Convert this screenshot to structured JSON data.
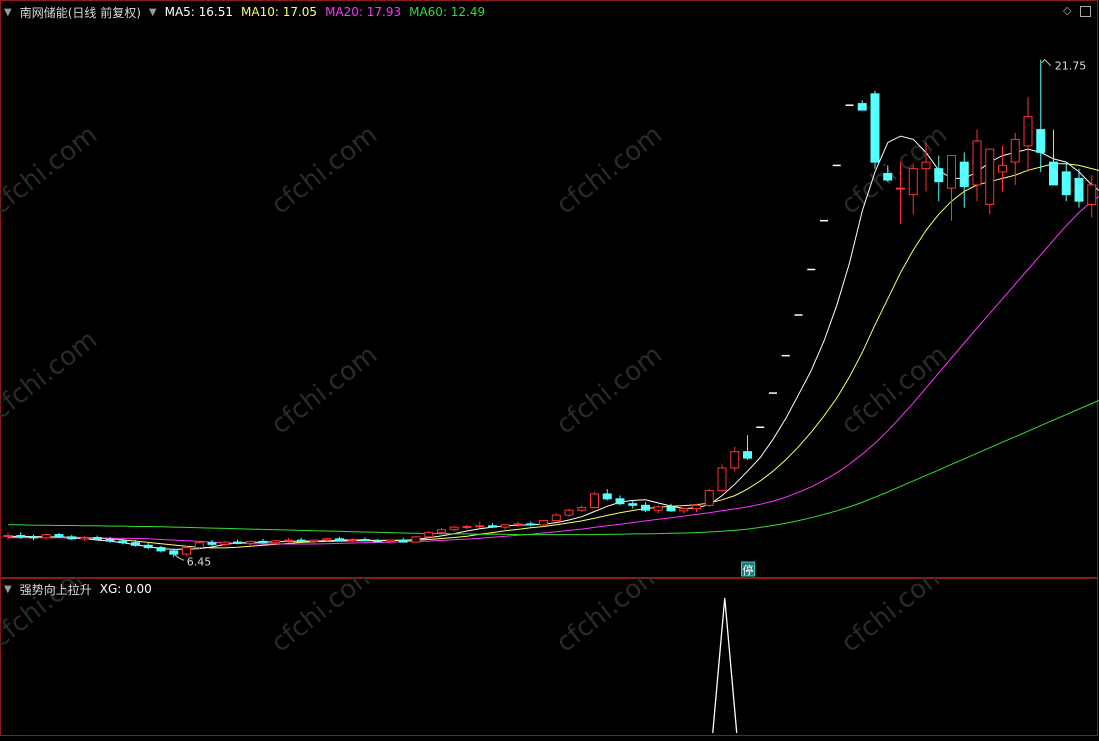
{
  "header": {
    "title": "南网储能(日线 前复权)",
    "ma_labels": [
      {
        "label": "MA5: 16.51",
        "color": "#ffffff"
      },
      {
        "label": "MA10: 17.05",
        "color": "#ffff66"
      },
      {
        "label": "MA20: 17.93",
        "color": "#ff33ff"
      },
      {
        "label": "MA60: 12.49",
        "color": "#33dd33"
      }
    ]
  },
  "indicator": {
    "title": "强势向上拉升",
    "value_label": "XG: 0.00"
  },
  "watermark": "cfchi.com",
  "colors": {
    "up": "#ff3333",
    "down": "#55ffff",
    "panel_border": "#8b1a1a",
    "ma5": "#ffffff",
    "ma10": "#ffff66",
    "ma20": "#ff33ff",
    "ma60": "#33dd33"
  },
  "chart_data": {
    "type": "candlestick",
    "y_range": [
      6.0,
      23.4
    ],
    "high_label": "21.75",
    "low_label": "6.45",
    "suspension_marker": "停",
    "candles": [
      [
        7.1,
        7.2,
        7.0,
        7.12
      ],
      [
        7.12,
        7.22,
        7.02,
        7.08
      ],
      [
        7.08,
        7.15,
        6.98,
        7.05
      ],
      [
        7.05,
        7.18,
        7.0,
        7.15
      ],
      [
        7.15,
        7.2,
        7.05,
        7.08
      ],
      [
        7.08,
        7.14,
        6.98,
        7.02
      ],
      [
        7.02,
        7.1,
        6.95,
        7.06
      ],
      [
        7.06,
        7.12,
        6.97,
        7.0
      ],
      [
        7.0,
        7.08,
        6.9,
        6.95
      ],
      [
        6.95,
        7.02,
        6.85,
        6.9
      ],
      [
        6.9,
        6.98,
        6.78,
        6.82
      ],
      [
        6.82,
        6.9,
        6.7,
        6.75
      ],
      [
        6.75,
        6.8,
        6.6,
        6.65
      ],
      [
        6.65,
        6.72,
        6.45,
        6.55
      ],
      [
        6.55,
        6.8,
        6.5,
        6.75
      ],
      [
        6.75,
        6.95,
        6.7,
        6.9
      ],
      [
        6.9,
        6.98,
        6.8,
        6.85
      ],
      [
        6.85,
        6.95,
        6.8,
        6.92
      ],
      [
        6.92,
        7.0,
        6.85,
        6.88
      ],
      [
        6.88,
        6.96,
        6.82,
        6.94
      ],
      [
        6.94,
        7.02,
        6.88,
        6.9
      ],
      [
        6.9,
        6.98,
        6.85,
        6.96
      ],
      [
        6.96,
        7.05,
        6.9,
        6.98
      ],
      [
        6.98,
        7.05,
        6.92,
        6.94
      ],
      [
        6.94,
        7.0,
        6.88,
        6.98
      ],
      [
        6.98,
        7.06,
        6.92,
        7.02
      ],
      [
        7.02,
        7.08,
        6.95,
        6.97
      ],
      [
        6.97,
        7.04,
        6.92,
        7.0
      ],
      [
        7.0,
        7.06,
        6.95,
        6.96
      ],
      [
        6.96,
        7.02,
        6.9,
        6.94
      ],
      [
        6.94,
        7.0,
        6.88,
        6.98
      ],
      [
        6.98,
        7.05,
        6.92,
        6.92
      ],
      [
        6.92,
        7.1,
        6.9,
        7.08
      ],
      [
        7.08,
        7.25,
        7.05,
        7.22
      ],
      [
        7.22,
        7.35,
        7.15,
        7.3
      ],
      [
        7.3,
        7.42,
        7.25,
        7.38
      ],
      [
        7.38,
        7.45,
        7.3,
        7.4
      ],
      [
        7.4,
        7.55,
        7.35,
        7.42
      ],
      [
        7.42,
        7.5,
        7.35,
        7.38
      ],
      [
        7.38,
        7.48,
        7.3,
        7.45
      ],
      [
        7.45,
        7.55,
        7.38,
        7.48
      ],
      [
        7.48,
        7.55,
        7.4,
        7.45
      ],
      [
        7.45,
        7.6,
        7.4,
        7.58
      ],
      [
        7.58,
        7.8,
        7.55,
        7.75
      ],
      [
        7.75,
        7.95,
        7.7,
        7.9
      ],
      [
        7.9,
        8.05,
        7.85,
        7.98
      ],
      [
        7.98,
        8.45,
        7.95,
        8.4
      ],
      [
        8.4,
        8.55,
        8.2,
        8.25
      ],
      [
        8.25,
        8.35,
        8.05,
        8.1
      ],
      [
        8.1,
        8.2,
        7.95,
        8.05
      ],
      [
        8.05,
        8.15,
        7.85,
        7.9
      ],
      [
        7.9,
        8.05,
        7.8,
        8.0
      ],
      [
        8.0,
        8.1,
        7.85,
        7.88
      ],
      [
        7.88,
        7.98,
        7.8,
        7.95
      ],
      [
        7.95,
        8.1,
        7.85,
        8.05
      ],
      [
        8.05,
        8.55,
        8.0,
        8.5
      ],
      [
        8.5,
        9.3,
        8.45,
        9.2
      ],
      [
        9.2,
        9.85,
        9.1,
        9.7
      ],
      [
        9.7,
        10.2,
        9.45,
        9.5
      ],
      [
        10.45,
        10.45,
        10.45,
        10.45
      ],
      [
        11.5,
        11.5,
        11.5,
        11.5
      ],
      [
        12.65,
        12.65,
        12.65,
        12.65
      ],
      [
        13.9,
        13.9,
        13.9,
        13.9
      ],
      [
        15.3,
        15.3,
        15.3,
        15.3
      ],
      [
        16.8,
        16.8,
        16.8,
        16.8
      ],
      [
        18.5,
        18.5,
        18.5,
        18.5
      ],
      [
        20.35,
        20.35,
        20.35,
        20.35
      ],
      [
        20.4,
        20.5,
        20.2,
        20.2
      ],
      [
        20.7,
        20.8,
        18.4,
        18.6
      ],
      [
        18.25,
        18.5,
        18.0,
        18.05
      ],
      [
        17.8,
        18.6,
        16.7,
        17.8
      ],
      [
        17.6,
        18.5,
        17.0,
        18.4
      ],
      [
        18.4,
        19.2,
        17.7,
        18.6
      ],
      [
        18.4,
        18.8,
        17.4,
        18.0
      ],
      [
        17.8,
        18.6,
        16.8,
        18.8
      ],
      [
        18.6,
        18.9,
        17.2,
        17.85
      ],
      [
        17.9,
        19.6,
        17.4,
        19.25
      ],
      [
        17.3,
        19.0,
        17.0,
        19.0
      ],
      [
        18.3,
        19.1,
        17.7,
        18.5
      ],
      [
        18.6,
        19.5,
        17.9,
        19.3
      ],
      [
        19.1,
        20.6,
        18.3,
        20.0
      ],
      [
        19.6,
        21.75,
        18.3,
        18.9
      ],
      [
        18.6,
        19.6,
        18.1,
        17.9
      ],
      [
        18.3,
        18.6,
        17.4,
        17.6
      ],
      [
        18.1,
        18.4,
        17.2,
        17.4
      ],
      [
        17.3,
        18.2,
        16.9,
        17.9
      ],
      [
        17.4,
        17.8,
        16.8,
        17.5
      ],
      [
        17.6,
        18.2,
        17.1,
        17.9
      ],
      [
        17.4,
        17.9,
        16.6,
        16.8
      ],
      [
        16.9,
        17.4,
        16.1,
        16.4
      ],
      [
        16.7,
        17.1,
        16.3,
        16.7
      ],
      [
        16.1,
        16.6,
        15.3,
        15.7
      ],
      [
        15.1,
        15.5,
        14.8,
        15.4
      ],
      [
        15.5,
        16.1,
        15.2,
        15.6
      ],
      [
        15.3,
        16.2,
        15.1,
        15.7
      ]
    ],
    "series": [
      {
        "name": "MA5",
        "values": [
          7.1,
          7.09,
          7.09,
          7.08,
          7.07,
          7.04,
          7.03,
          6.98,
          6.95,
          6.9,
          6.84,
          6.78,
          6.72,
          6.7,
          6.7,
          6.72,
          6.77,
          6.85,
          6.89,
          6.91,
          6.92,
          6.93,
          6.94,
          6.95,
          6.95,
          6.96,
          6.98,
          6.99,
          6.98,
          6.97,
          6.98,
          6.97,
          7.0,
          7.05,
          7.11,
          7.18,
          7.26,
          7.33,
          7.38,
          7.42,
          7.44,
          7.45,
          7.47,
          7.52,
          7.6,
          7.7,
          7.86,
          8.02,
          8.15,
          8.2,
          8.22,
          8.12,
          8.03,
          7.95,
          7.97,
          8.07,
          8.35,
          8.7,
          9.1,
          9.52,
          10.08,
          10.72,
          11.45,
          12.2,
          13.1,
          14.2,
          15.5,
          17.1,
          18.3,
          19.2,
          19.4,
          19.3,
          18.9,
          18.35,
          18.1,
          18.1,
          18.3,
          18.6,
          18.8,
          18.9,
          19.0,
          18.9,
          18.7,
          18.6,
          18.3,
          17.9,
          17.6,
          17.5,
          17.3,
          17.1,
          16.8,
          16.4,
          16.0,
          15.7,
          15.5
        ]
      },
      {
        "name": "MA10",
        "values": [
          7.08,
          7.08,
          7.08,
          7.08,
          7.08,
          7.07,
          7.06,
          7.04,
          7.02,
          6.99,
          6.95,
          6.91,
          6.87,
          6.83,
          6.79,
          6.76,
          6.74,
          6.74,
          6.76,
          6.79,
          6.82,
          6.85,
          6.88,
          6.91,
          6.93,
          6.94,
          6.95,
          6.96,
          6.96,
          6.96,
          6.97,
          6.97,
          6.98,
          7.0,
          7.03,
          7.06,
          7.1,
          7.16,
          7.21,
          7.27,
          7.31,
          7.36,
          7.4,
          7.45,
          7.51,
          7.57,
          7.65,
          7.74,
          7.82,
          7.89,
          7.95,
          7.99,
          8.02,
          8.04,
          8.07,
          8.12,
          8.22,
          8.35,
          8.55,
          8.8,
          9.1,
          9.45,
          9.85,
          10.3,
          10.8,
          11.35,
          12.0,
          12.75,
          13.6,
          14.4,
          15.2,
          15.9,
          16.5,
          17.0,
          17.4,
          17.7,
          17.9,
          18.0,
          18.1,
          18.2,
          18.35,
          18.45,
          18.55,
          18.55,
          18.5,
          18.4,
          18.3,
          18.2,
          18.0,
          17.8,
          17.55,
          17.25,
          16.95,
          16.65,
          16.4
        ]
      },
      {
        "name": "MA20",
        "values": [
          7.05,
          7.05,
          7.05,
          7.05,
          7.05,
          7.05,
          7.05,
          7.05,
          7.04,
          7.04,
          7.03,
          7.02,
          7.0,
          6.98,
          6.96,
          6.94,
          6.92,
          6.9,
          6.88,
          6.87,
          6.86,
          6.86,
          6.86,
          6.86,
          6.86,
          6.87,
          6.88,
          6.89,
          6.9,
          6.91,
          6.92,
          6.93,
          6.94,
          6.95,
          6.97,
          6.99,
          7.01,
          7.04,
          7.07,
          7.1,
          7.13,
          7.16,
          7.2,
          7.24,
          7.28,
          7.32,
          7.37,
          7.42,
          7.47,
          7.52,
          7.57,
          7.62,
          7.67,
          7.72,
          7.77,
          7.82,
          7.88,
          7.94,
          8.0,
          8.08,
          8.18,
          8.3,
          8.45,
          8.62,
          8.82,
          9.05,
          9.32,
          9.62,
          9.96,
          10.34,
          10.76,
          11.2,
          11.66,
          12.12,
          12.58,
          13.04,
          13.5,
          13.95,
          14.4,
          14.85,
          15.3,
          15.75,
          16.2,
          16.65,
          17.05,
          17.4,
          17.65,
          17.85,
          18.0,
          18.1,
          18.12,
          18.1,
          18.05,
          17.98,
          17.93
        ]
      },
      {
        "name": "MA60",
        "values": [
          7.45,
          7.45,
          7.44,
          7.44,
          7.43,
          7.43,
          7.42,
          7.42,
          7.41,
          7.41,
          7.4,
          7.4,
          7.39,
          7.38,
          7.37,
          7.36,
          7.35,
          7.34,
          7.33,
          7.32,
          7.31,
          7.3,
          7.29,
          7.28,
          7.27,
          7.26,
          7.25,
          7.24,
          7.23,
          7.22,
          7.21,
          7.2,
          7.19,
          7.18,
          7.18,
          7.17,
          7.17,
          7.16,
          7.16,
          7.16,
          7.15,
          7.15,
          7.15,
          7.15,
          7.15,
          7.15,
          7.15,
          7.16,
          7.16,
          7.17,
          7.17,
          7.18,
          7.19,
          7.2,
          7.21,
          7.23,
          7.25,
          7.28,
          7.32,
          7.37,
          7.43,
          7.5,
          7.58,
          7.67,
          7.77,
          7.88,
          8.0,
          8.14,
          8.3,
          8.46,
          8.63,
          8.8,
          8.97,
          9.14,
          9.31,
          9.48,
          9.65,
          9.82,
          9.99,
          10.16,
          10.33,
          10.5,
          10.67,
          10.84,
          11.01,
          11.18,
          11.35,
          11.52,
          11.68,
          11.84,
          11.99,
          12.13,
          12.26,
          12.38,
          12.49
        ]
      }
    ],
    "indicator_series": {
      "name": "XG",
      "signal_index": 57,
      "y_range": [
        0,
        1
      ]
    }
  }
}
